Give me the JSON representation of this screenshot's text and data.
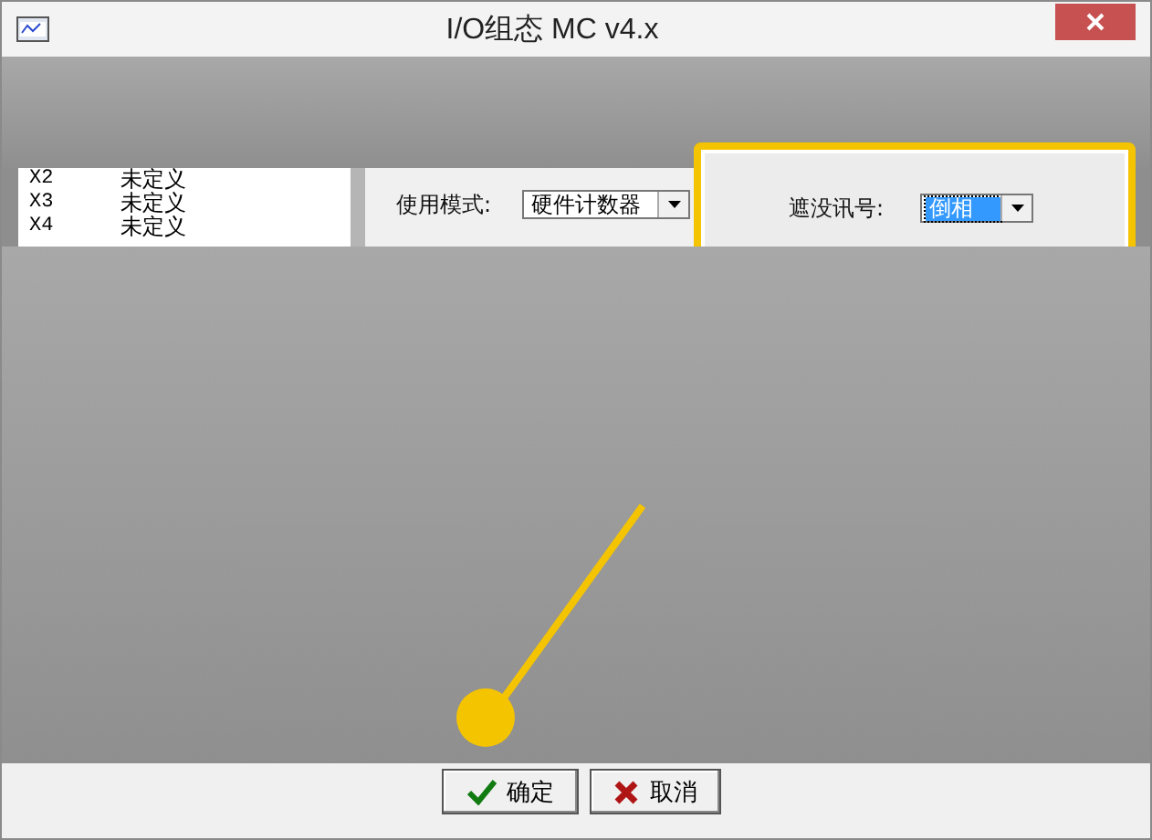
{
  "window": {
    "title": "I/O组态 MC v4.x"
  },
  "io_list": [
    {
      "name": "X2",
      "value": "未定义"
    },
    {
      "name": "X3",
      "value": "未定义"
    },
    {
      "name": "X4",
      "value": "未定义"
    }
  ],
  "settings": [
    {
      "label": "使用模式:",
      "value": "硬件计数器",
      "highlighted": false,
      "focused": false
    },
    {
      "label": "遮没讯号:",
      "value": "倒相",
      "highlighted": true,
      "focused": true
    }
  ],
  "buttons": [
    {
      "kind": "ok",
      "label": "确定"
    },
    {
      "kind": "cancel",
      "label": "取消"
    }
  ]
}
